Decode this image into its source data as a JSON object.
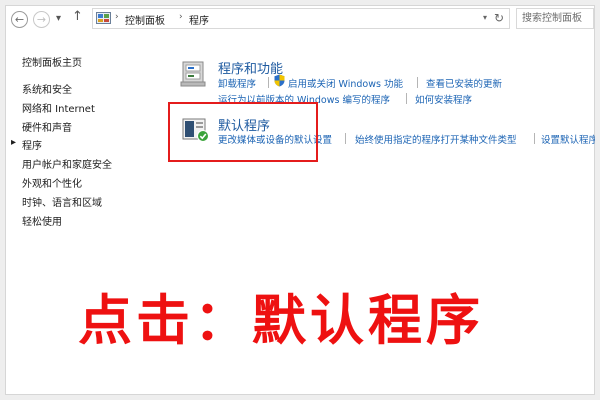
{
  "nav": {
    "back_arrow": "←",
    "forward_arrow": "→",
    "recent_arrow": "▾",
    "up_arrow": "↑"
  },
  "address": {
    "icon": "control-panel-icon",
    "breadcrumb": [
      "控制面板",
      "程序"
    ],
    "separator": "›",
    "dropdown": "▾",
    "refresh": "↻"
  },
  "search": {
    "placeholder": "搜索控制面板"
  },
  "sidebar": {
    "title": "控制面板主页",
    "items": [
      {
        "label": "系统和安全"
      },
      {
        "label": "网络和 Internet"
      },
      {
        "label": "硬件和声音"
      },
      {
        "label": "程序",
        "selected": true
      },
      {
        "label": "用户帐户和家庭安全"
      },
      {
        "label": "外观和个性化"
      },
      {
        "label": "时钟、语言和区域"
      },
      {
        "label": "轻松使用"
      }
    ],
    "selected_marker": "▸"
  },
  "categories": [
    {
      "title": "程序和功能",
      "icon": "programs-features-icon",
      "links": [
        "卸载程序",
        "启用或关闭 Windows 功能",
        "查看已安装的更新",
        "运行为以前版本的 Windows 编写的程序",
        "如何安装程序"
      ]
    },
    {
      "title": "默认程序",
      "icon": "default-programs-icon",
      "links": [
        "更改媒体或设备的默认设置",
        "始终使用指定的程序打开某种文件类型",
        "设置默认程序"
      ]
    }
  ],
  "overlay": {
    "text": "点击：默认程序"
  },
  "colors": {
    "link": "#1c64b4",
    "category_title": "#1e5aa0",
    "highlight": "#e41c1c",
    "overlay_text": "#ee1111",
    "shield_blue": "#2a6fc9",
    "shield_yellow": "#f2c400"
  }
}
